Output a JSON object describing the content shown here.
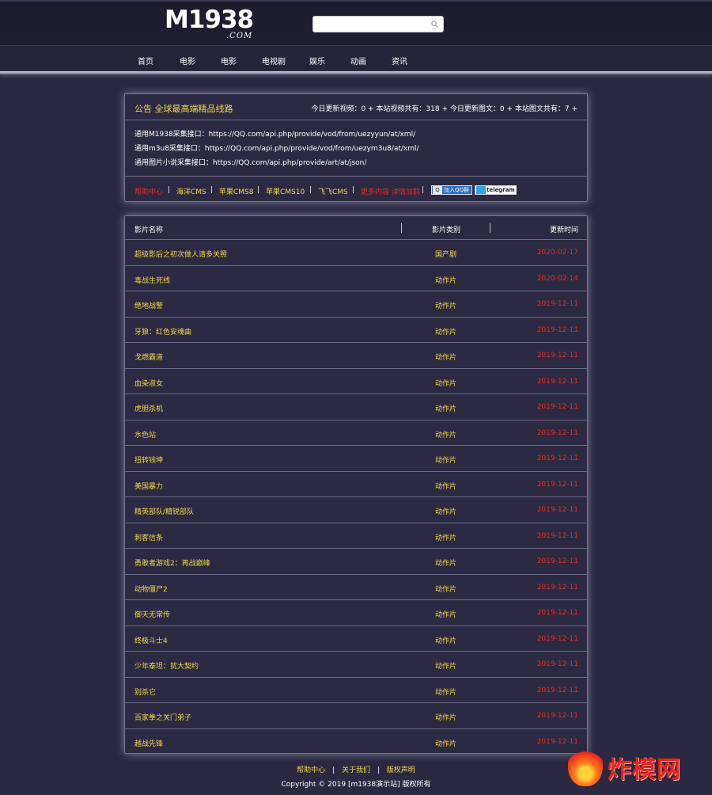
{
  "header": {
    "logo_main": "M1938",
    "logo_sub": ".COM",
    "search_placeholder": ""
  },
  "nav": [
    "首页",
    "电影",
    "电影",
    "电视剧",
    "娱乐",
    "动画",
    "资讯"
  ],
  "notice": {
    "title": "公告 全球最高端精品线路",
    "stats": "今日更新视频：0 + 本站视频共有：318 + 今日更新图文：0 + 本站图文共有：7 +",
    "api_lines": [
      "通用M1938采集接口：https://QQ.com/api.php/provide/vod/from/uezyyun/at/xml/",
      "通用m3u8采集接口：https://QQ.com/api.php/provide/vod/from/uezym3u8/at/xml/",
      "通用图片小说采集接口：https://QQ.com/api.php/provide/art/at/json/"
    ],
    "links": {
      "help": "帮助中心",
      "haiyang": "海洋CMS",
      "apple8": "苹果CMS8",
      "apple10": "苹果CMS10",
      "feifei": "飞飞CMS",
      "more": "更多内容 详情加群",
      "qq_badge": "加入QQ群",
      "tg_badge": "telegram"
    }
  },
  "table": {
    "headers": {
      "name": "影片名称",
      "category": "影片类别",
      "updated": "更新时间"
    },
    "rows": [
      {
        "name": "超级影后之初次做人请多关照",
        "category": "国产剧",
        "date": "2020-02-17"
      },
      {
        "name": "毒战生死线",
        "category": "动作片",
        "date": "2020-02-14"
      },
      {
        "name": "绝地战警",
        "category": "动作片",
        "date": "2019-12-11"
      },
      {
        "name": "牙狼：红色安魂曲",
        "category": "动作片",
        "date": "2019-12-11"
      },
      {
        "name": "戈燃霸道",
        "category": "动作片",
        "date": "2019-12-11"
      },
      {
        "name": "血染淑女",
        "category": "动作片",
        "date": "2019-12-11"
      },
      {
        "name": "虎胆杀机",
        "category": "动作片",
        "date": "2019-12-11"
      },
      {
        "name": "水色站",
        "category": "动作片",
        "date": "2019-12-11"
      },
      {
        "name": "扭转钱坤",
        "category": "动作片",
        "date": "2019-12-11"
      },
      {
        "name": "美国暴力",
        "category": "动作片",
        "date": "2019-12-11"
      },
      {
        "name": "精英部队/精锐部队",
        "category": "动作片",
        "date": "2019-12-11"
      },
      {
        "name": "刺客信条",
        "category": "动作片",
        "date": "2019-12-11"
      },
      {
        "name": "勇敢者游戏2：再战巅峰",
        "category": "动作片",
        "date": "2019-12-11"
      },
      {
        "name": "动物僵尸2",
        "category": "动作片",
        "date": "2019-12-11"
      },
      {
        "name": "御天无常传",
        "category": "动作片",
        "date": "2019-12-11"
      },
      {
        "name": "终极斗士4",
        "category": "动作片",
        "date": "2019-12-11"
      },
      {
        "name": "少年泰坦：犹大契约",
        "category": "动作片",
        "date": "2019-12-11"
      },
      {
        "name": "别杀它",
        "category": "动作片",
        "date": "2019-12-11"
      },
      {
        "name": "百家拳之关门弟子",
        "category": "动作片",
        "date": "2019-12-11"
      },
      {
        "name": "越战先锋",
        "category": "动作片",
        "date": "2019-12-11"
      }
    ]
  },
  "footer": {
    "links": [
      "帮助中心",
      "关于我们",
      "版权声明"
    ],
    "copyright": "Copyright © 2019 [m1938演示站] 版权所有"
  },
  "watermark": {
    "text": "炸模网"
  },
  "colors": {
    "background": "#2b2942",
    "accent_yellow": "#f0d84a",
    "accent_red": "#e22a2a"
  }
}
